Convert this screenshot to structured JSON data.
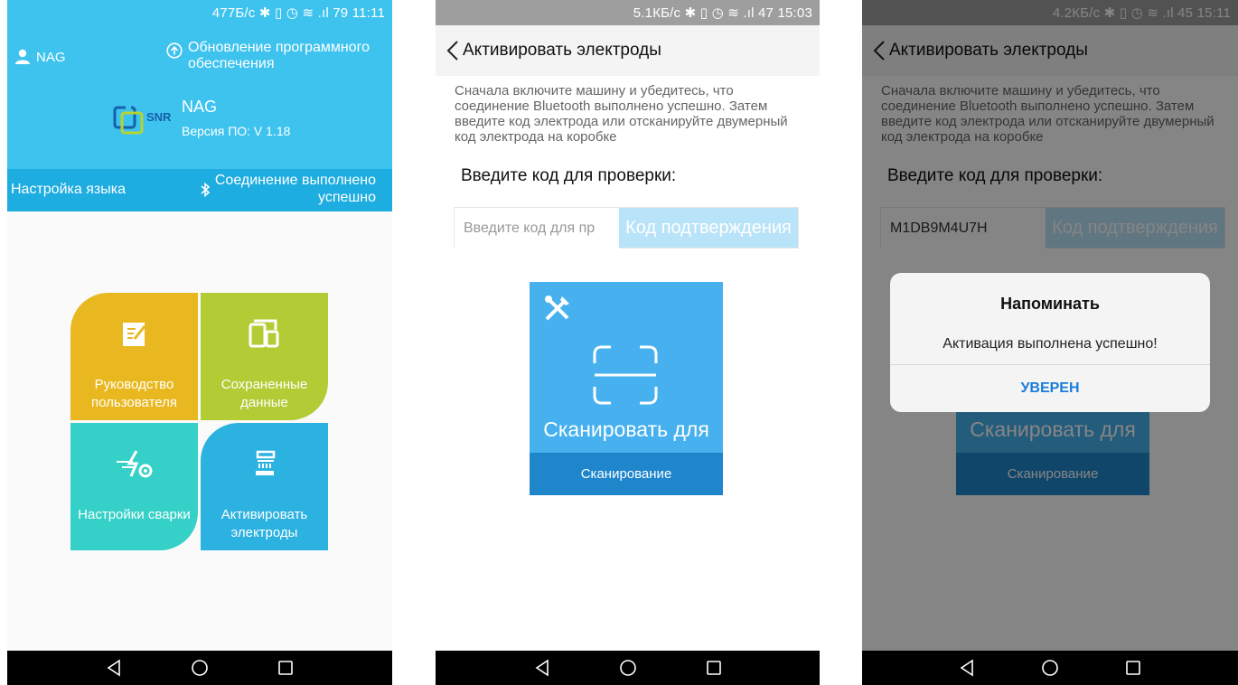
{
  "screen1": {
    "status": "477Б/с ✱ ▯ ◷ ≋ .ıl 79 11:11",
    "user_name": "NAG",
    "update_label": "Обновление программного обеспечения",
    "brand_logo_text": "SNR",
    "brand_name": "NAG",
    "version": "Версия ПО: V 1.18",
    "language_setting": "Настройка языка",
    "connection_status": "Соединение выполнено успешно",
    "tiles": {
      "manual": "Руководство пользователя",
      "saved": "Сохраненные данные",
      "weld": "Настройки сварки",
      "activate": "Активировать электроды"
    },
    "colors": {
      "header": "#3ec3ef",
      "settings_bar": "#1dade0",
      "manual": "#e9b820",
      "saved": "#b3cc36",
      "weld": "#35d0c8",
      "activate": "#2cb2e0"
    }
  },
  "screen2": {
    "status": "5.1КБ/с ✱ ▯ ◷ ≋ .ıl 47 15:03",
    "title": "Активировать электроды",
    "description": "Сначала включите машину и убедитесь, что соединение Bluetooth выполнено успешно. Затем введите код электрода или отсканируйте двумерный код электрода на коробке",
    "prompt": "Введите код для проверки:",
    "code_placeholder": "Введите код для пр",
    "verify_button": "Код подтверждения",
    "scan_title": "Сканировать для",
    "scan_button": "Сканирование",
    "colors": {
      "scan_card": "#46b1ee",
      "scan_button": "#1f86cc",
      "verify_button": "#b9e3f8"
    }
  },
  "screen3": {
    "status": "4.2КБ/с ✱ ▯ ◷ ≋ .ıl 45 15:11",
    "title": "Активировать электроды",
    "description": "Сначала включите машину и убедитесь, что соединение Bluetooth выполнено успешно. Затем введите код электрода или отсканируйте двумерный код электрода на коробке",
    "prompt": "Введите код для проверки:",
    "code_value": "M1DB9M4U7H",
    "verify_button": "Код подтверждения",
    "scan_title": "Сканировать для",
    "scan_button": "Сканирование",
    "dialog_title": "Напоминать",
    "dialog_message": "Активация выполнена успешно!",
    "dialog_button": "УВЕРЕН",
    "colors": {
      "dialog_button": "#1a7ddb"
    }
  },
  "nav": {
    "icons": [
      "back-triangle-icon",
      "home-circle-icon",
      "recent-square-icon"
    ]
  }
}
